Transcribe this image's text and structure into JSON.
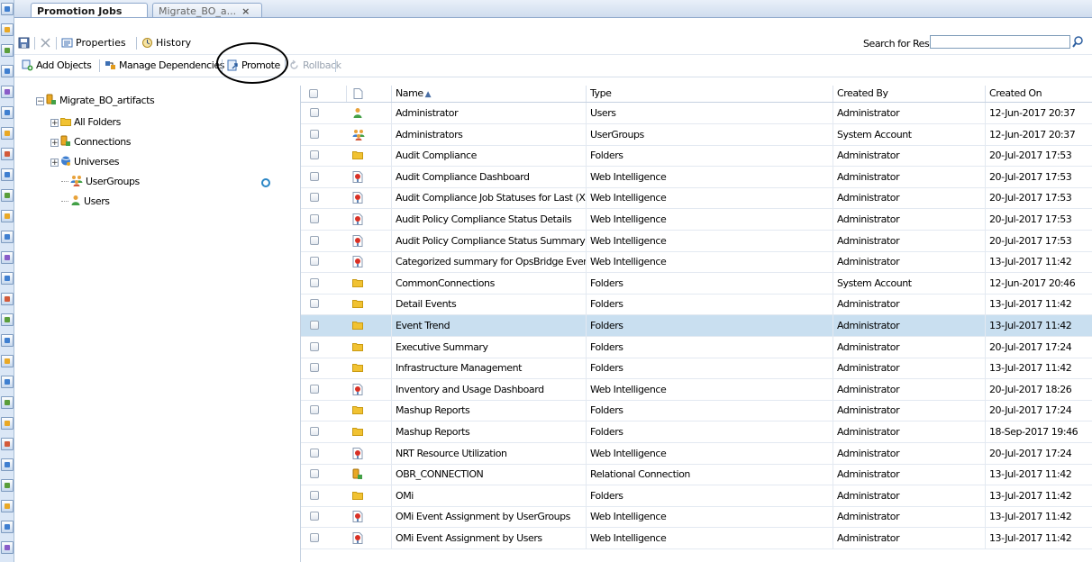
{
  "tabs": [
    {
      "label": "Promotion Jobs",
      "active": true
    },
    {
      "label": "Migrate_BO_a...",
      "close": "×"
    }
  ],
  "toolbar1": {
    "properties": "Properties",
    "history": "History",
    "search_label": "Search for Resources",
    "search_value": ""
  },
  "toolbar2": {
    "add_objects": "Add Objects",
    "manage_dependencies": "Manage Dependencies",
    "promote": "Promote",
    "rollback": "Rollback"
  },
  "tree": {
    "root": "Migrate_BO_artifacts",
    "root_expander": "−",
    "children": [
      {
        "label": "All Folders",
        "expander": "+",
        "icon": "folder-icon"
      },
      {
        "label": "Connections",
        "expander": "+",
        "icon": "connection-icon"
      },
      {
        "label": "Universes",
        "expander": "+",
        "icon": "universe-icon"
      },
      {
        "label": "UserGroups",
        "expander": "",
        "icon": "usergroup-icon"
      },
      {
        "label": "Users",
        "expander": "",
        "icon": "user-icon"
      }
    ]
  },
  "grid": {
    "columns": [
      "Name",
      "Type",
      "Created By",
      "Created On"
    ],
    "rows": [
      {
        "name": "Administrator",
        "type": "Users",
        "created_by": "Administrator",
        "created_on": "12-Jun-2017 20:37",
        "icon": "user"
      },
      {
        "name": "Administrators",
        "type": "UserGroups",
        "created_by": "System Account",
        "created_on": "12-Jun-2017 20:37",
        "icon": "usergroup"
      },
      {
        "name": "Audit Compliance",
        "type": "Folders",
        "created_by": "Administrator",
        "created_on": "20-Jul-2017 17:53",
        "icon": "folder"
      },
      {
        "name": "Audit Compliance Dashboard",
        "type": "Web Intelligence",
        "created_by": "Administrator",
        "created_on": "20-Jul-2017 17:53",
        "icon": "webi"
      },
      {
        "name": "Audit Compliance Job Statuses for Last (X) Days",
        "type": "Web Intelligence",
        "created_by": "Administrator",
        "created_on": "20-Jul-2017 17:53",
        "icon": "webi"
      },
      {
        "name": "Audit Policy Compliance Status Details",
        "type": "Web Intelligence",
        "created_by": "Administrator",
        "created_on": "20-Jul-2017 17:53",
        "icon": "webi"
      },
      {
        "name": "Audit Policy Compliance Status Summary",
        "type": "Web Intelligence",
        "created_by": "Administrator",
        "created_on": "20-Jul-2017 17:53",
        "icon": "webi"
      },
      {
        "name": "Categorized summary for OpsBridge Events",
        "type": "Web Intelligence",
        "created_by": "Administrator",
        "created_on": "13-Jul-2017 11:42",
        "icon": "webi"
      },
      {
        "name": "CommonConnections",
        "type": "Folders",
        "created_by": "System Account",
        "created_on": "12-Jun-2017 20:46",
        "icon": "folder"
      },
      {
        "name": "Detail Events",
        "type": "Folders",
        "created_by": "Administrator",
        "created_on": "13-Jul-2017 11:42",
        "icon": "folder"
      },
      {
        "name": "Event Trend",
        "type": "Folders",
        "created_by": "Administrator",
        "created_on": "13-Jul-2017 11:42",
        "icon": "folder",
        "selected": true
      },
      {
        "name": "Executive Summary",
        "type": "Folders",
        "created_by": "Administrator",
        "created_on": "20-Jul-2017 17:24",
        "icon": "folder"
      },
      {
        "name": "Infrastructure Management",
        "type": "Folders",
        "created_by": "Administrator",
        "created_on": "13-Jul-2017 11:42",
        "icon": "folder"
      },
      {
        "name": "Inventory and Usage Dashboard",
        "type": "Web Intelligence",
        "created_by": "Administrator",
        "created_on": "20-Jul-2017 18:26",
        "icon": "webi"
      },
      {
        "name": "Mashup Reports",
        "type": "Folders",
        "created_by": "Administrator",
        "created_on": "20-Jul-2017 17:24",
        "icon": "folder"
      },
      {
        "name": "Mashup Reports",
        "type": "Folders",
        "created_by": "Administrator",
        "created_on": "18-Sep-2017 19:46",
        "icon": "folder"
      },
      {
        "name": "NRT Resource Utilization",
        "type": "Web Intelligence",
        "created_by": "Administrator",
        "created_on": "20-Jul-2017 17:24",
        "icon": "webi"
      },
      {
        "name": "OBR_CONNECTION",
        "type": "Relational Connection",
        "created_by": "Administrator",
        "created_on": "13-Jul-2017 11:42",
        "icon": "connection"
      },
      {
        "name": "OMi",
        "type": "Folders",
        "created_by": "Administrator",
        "created_on": "13-Jul-2017 11:42",
        "icon": "folder"
      },
      {
        "name": "OMi Event Assignment by UserGroups",
        "type": "Web Intelligence",
        "created_by": "Administrator",
        "created_on": "13-Jul-2017 11:42",
        "icon": "webi"
      },
      {
        "name": "OMi Event Assignment by Users",
        "type": "Web Intelligence",
        "created_by": "Administrator",
        "created_on": "13-Jul-2017 11:42",
        "icon": "webi"
      }
    ]
  },
  "colors": {
    "accent": "#1f4e8c",
    "selected_row": "#c9dff0",
    "folder": "#f1c232",
    "webi_red": "#d93025"
  }
}
